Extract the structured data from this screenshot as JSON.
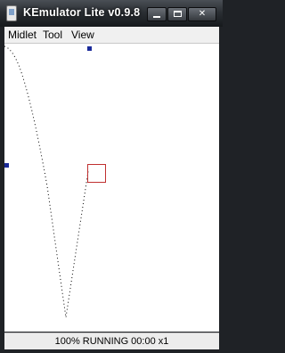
{
  "window": {
    "title": "KEmulator Lite v0.9.8",
    "controls": {
      "close_label": "✕"
    }
  },
  "menu": {
    "items": [
      {
        "label": "Midlet"
      },
      {
        "label": "Tool"
      },
      {
        "label": "View"
      }
    ]
  },
  "status": {
    "text": "100% RUNNING 00:00 x1"
  },
  "colors": {
    "marker": "#1a2a9a",
    "box": "#c03030",
    "trail": "#000000"
  }
}
